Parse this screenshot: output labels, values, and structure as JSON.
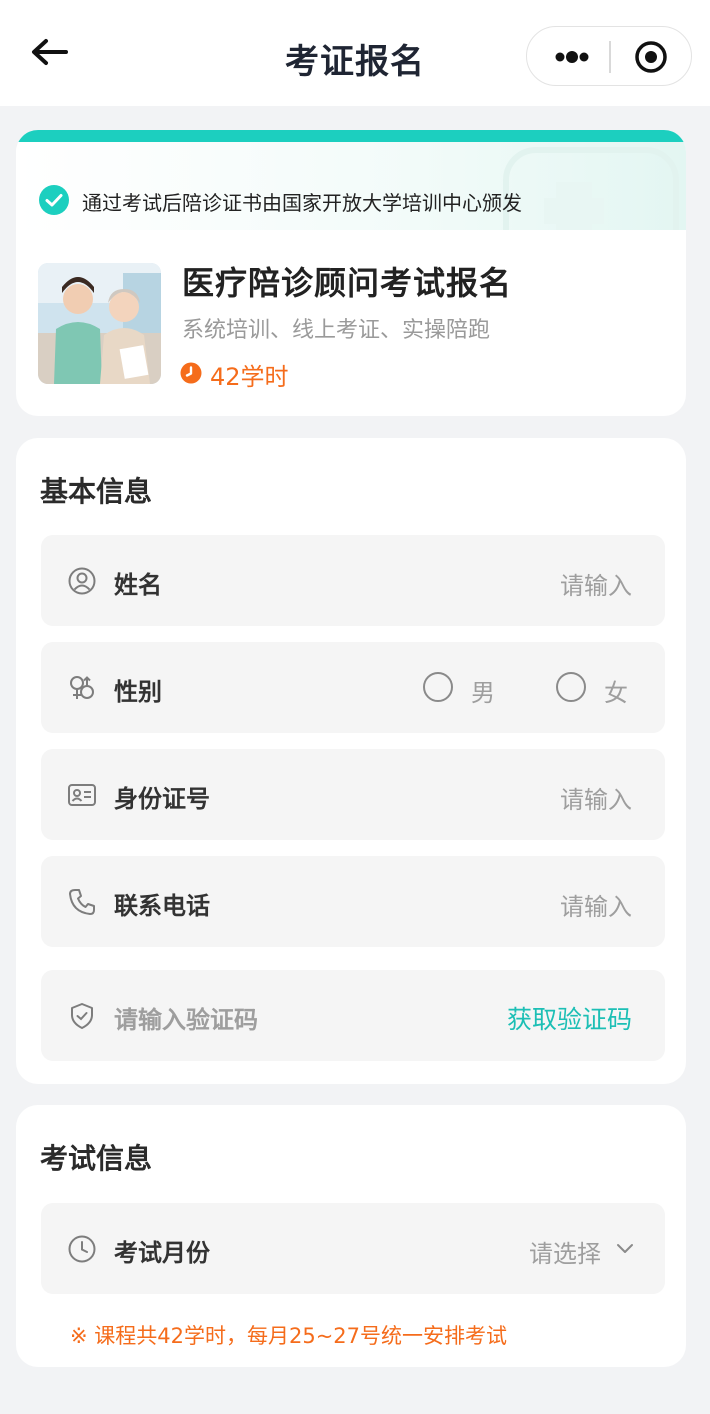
{
  "nav": {
    "title": "考证报名",
    "back_icon": "arrow-left-icon",
    "more_icon": "more-dots-icon",
    "close_icon": "target-close-icon"
  },
  "course": {
    "banner_text": "通过考试后陪诊证书由国家开放大学培训中心颁发",
    "title": "医疗陪诊顾问考试报名",
    "subtitle": "系统培训、线上考证、实操陪跑",
    "hours": "42学时"
  },
  "basic": {
    "section_title": "基本信息",
    "fields": {
      "name": {
        "label": "姓名",
        "placeholder": "请输入"
      },
      "gender": {
        "label": "性别",
        "options": [
          "男",
          "女"
        ]
      },
      "id": {
        "label": "身份证号",
        "placeholder": "请输入"
      },
      "phone": {
        "label": "联系电话",
        "placeholder": "请输入"
      },
      "code": {
        "placeholder": "请输入验证码",
        "action": "获取验证码"
      }
    }
  },
  "exam": {
    "section_title": "考试信息",
    "month": {
      "label": "考试月份",
      "placeholder": "请选择"
    },
    "note": "※ 课程共42学时，每月25~27号统一安排考试"
  },
  "colors": {
    "accent": "#1ccfbf",
    "orange": "#f56c1b",
    "background": "#f2f3f5"
  }
}
